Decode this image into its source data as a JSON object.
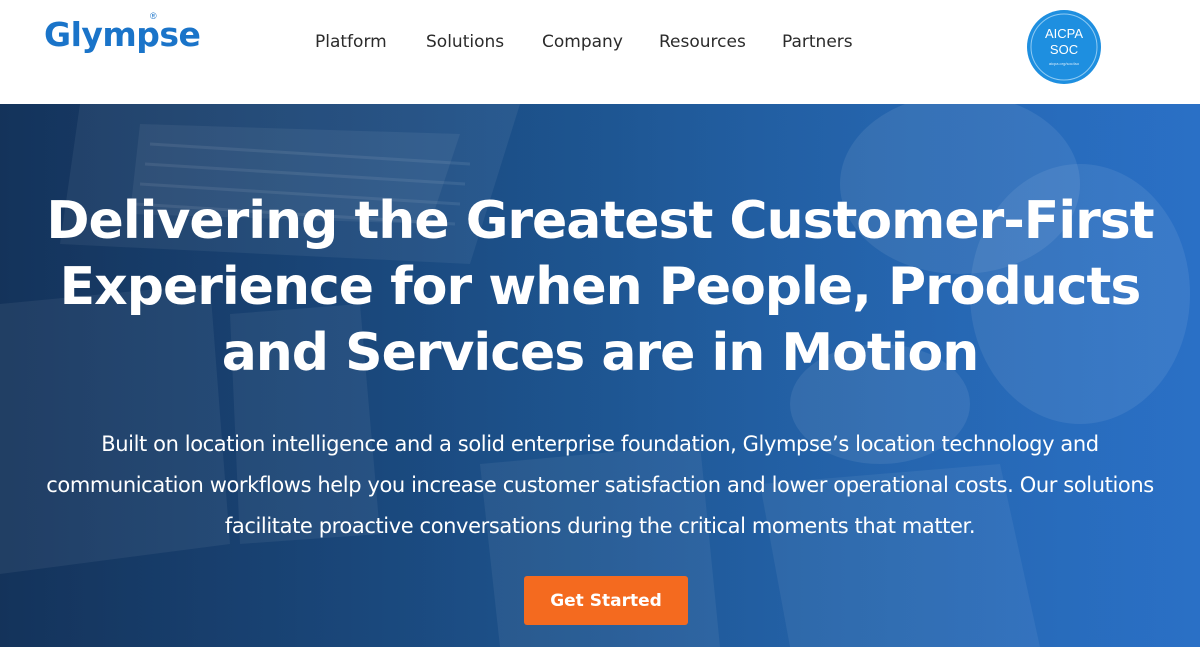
{
  "header": {
    "logo_text": "Glympse",
    "logo_mark": "®",
    "nav": [
      {
        "label": "Platform"
      },
      {
        "label": "Solutions"
      },
      {
        "label": "Company"
      },
      {
        "label": "Resources"
      },
      {
        "label": "Partners"
      }
    ],
    "badge": {
      "line1": "AICPA",
      "line2": "SOC",
      "small": "aicpa.org/soc4so"
    }
  },
  "hero": {
    "headline": "Delivering the Greatest Customer-First Experience for when People, Products and Services are in Motion",
    "subtext": "Built on location intelligence and a solid enterprise foundation, Glympse’s location technology and communication workflows help you increase customer satisfaction and lower operational costs. Our solutions facilitate proactive conversations during the critical moments that matter.",
    "cta_label": "Get Started"
  },
  "colors": {
    "brand_blue": "#1a74c9",
    "hero_blue": "#1f5a98",
    "cta_orange": "#f46a1f",
    "badge_blue": "#1e8fe0"
  },
  "icons": {
    "badge": "aicpa-soc-badge"
  }
}
